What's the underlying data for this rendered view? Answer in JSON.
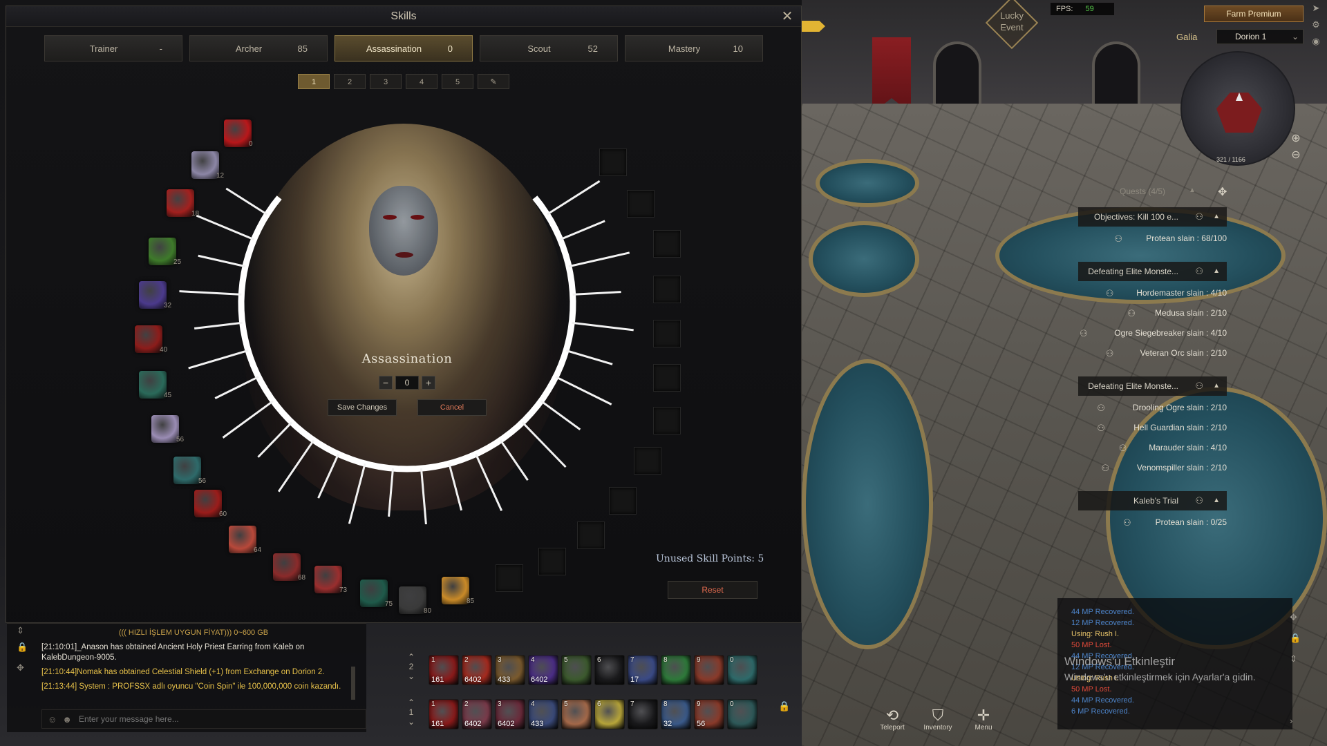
{
  "skills_window": {
    "title": "Skills",
    "class_tabs": [
      {
        "label": "Trainer",
        "value": "-"
      },
      {
        "label": "Archer",
        "value": "85"
      },
      {
        "label": "Assassination",
        "value": "0",
        "active": true
      },
      {
        "label": "Scout",
        "value": "52"
      },
      {
        "label": "Mastery",
        "value": "10"
      }
    ],
    "preset_tabs": [
      "1",
      "2",
      "3",
      "4",
      "5"
    ],
    "skill_levels": [
      "0",
      "12",
      "18",
      "25",
      "32",
      "40",
      "45",
      "56",
      "56",
      "60",
      "64",
      "68",
      "73",
      "75",
      "80",
      "85"
    ],
    "center": {
      "title": "Assassination",
      "points": "0",
      "minus": "−",
      "plus": "+",
      "save_label": "Save Changes",
      "cancel_label": "Cancel"
    },
    "unused_points": "Unused Skill Points:  5",
    "reset_label": "Reset"
  },
  "chat": {
    "top_line": "((( HIZLI İŞLEM UYGUN FİYAT))) 0~600 GB",
    "lines": [
      {
        "text": "[21:10:01]_Anason has obtained Ancient Holy Priest Earring from Kaleb on KalebDungeon-9005.",
        "color": "#e6e1d5"
      },
      {
        "text": "[21:10:44]Nomak has obtained Celestial Shield (+1) from Exchange on Dorion 2.",
        "color": "#e8c24a"
      },
      {
        "text": "[21:13:44] System :  PROFSSX adlı oyuncu \"Coin Spin\" ile 100,000,000 coin kazandı.",
        "color": "#e8c24a"
      }
    ],
    "placeholder": "Enter your message here..."
  },
  "hotbar_top": [
    {
      "key": "1",
      "count": "161",
      "color": "#8a1a1a"
    },
    {
      "key": "2",
      "count": "6402",
      "color": "#a62a1e"
    },
    {
      "key": "3",
      "count": "433",
      "color": "#7a5a2e"
    },
    {
      "key": "4",
      "count": "6402",
      "color": "#4b2d86"
    },
    {
      "key": "5",
      "count": "",
      "color": "#3c5a2e"
    },
    {
      "key": "6",
      "count": "",
      "color": "#1a1a1c"
    },
    {
      "key": "7",
      "count": "17",
      "color": "#3a4a86"
    },
    {
      "key": "8",
      "count": "",
      "color": "#2e7a3a"
    },
    {
      "key": "9",
      "count": "",
      "color": "#8a3a2a"
    },
    {
      "key": "0",
      "count": "",
      "color": "#2e6a6a"
    }
  ],
  "hotbar_bottom": [
    {
      "key": "1",
      "count": "161",
      "color": "#8a1a1a"
    },
    {
      "key": "2",
      "count": "6402",
      "color": "#7a3a4a"
    },
    {
      "key": "3",
      "count": "6402",
      "color": "#6a2a3a"
    },
    {
      "key": "4",
      "count": "433",
      "color": "#3a4a7a"
    },
    {
      "key": "5",
      "count": "",
      "color": "#a66a4a"
    },
    {
      "key": "6",
      "count": "",
      "color": "#b8a63a"
    },
    {
      "key": "7",
      "count": "",
      "color": "#1a1a1c"
    },
    {
      "key": "8",
      "count": "32",
      "color": "#3a5a8a"
    },
    {
      "key": "9",
      "count": "56",
      "color": "#8a3a2a"
    },
    {
      "key": "0",
      "count": "",
      "color": "#2e5a5a"
    }
  ],
  "hotbar_page_top": "2",
  "hotbar_page_bottom": "1",
  "bottom_menu": [
    {
      "label": "Teleport",
      "icon": "teleport-icon"
    },
    {
      "label": "Inventory",
      "icon": "inventory-icon"
    },
    {
      "label": "Menu",
      "icon": "menu-icon"
    }
  ],
  "combat_log": [
    {
      "text": "44 MP Recovered.",
      "type": "hpc"
    },
    {
      "text": "12 MP Recovered.",
      "type": "hpc"
    },
    {
      "text": "Using: Rush I.",
      "type": "use"
    },
    {
      "text": "50 MP Lost.",
      "type": "mpl"
    },
    {
      "text": "44 MP Recovered.",
      "type": "hpc"
    },
    {
      "text": "12 MP Recovered.",
      "type": "hpc"
    },
    {
      "text": "Using: Rush I.",
      "type": "use"
    },
    {
      "text": "50 MP Lost.",
      "type": "mpl"
    },
    {
      "text": "44 MP Recovered.",
      "type": "hpc"
    },
    {
      "text": "6 MP Recovered.",
      "type": "hpc"
    }
  ],
  "windows_watermark": {
    "line1": "Windows'u Etkinleştir",
    "line2": "Windows'u etkinleştirmek için Ayarlar'a gidin."
  },
  "hud": {
    "fps_label": "FPS:",
    "fps_value": "59",
    "farm_premium": "Farm Premium",
    "region": "Galia",
    "channel": "Dorion 1",
    "coords": "321 / 1166",
    "lucky_event": "Lucky Event"
  },
  "quests": {
    "title": "Quests (4/5)",
    "groups": [
      {
        "name": "Objectives: Kill 100 e...",
        "objectives": [
          "Protean slain : 68/100"
        ]
      },
      {
        "name": "Defeating Elite Monste...",
        "objectives": [
          "Hordemaster slain : 4/10",
          "Medusa slain : 2/10",
          "Ogre Siegebreaker slain : 4/10",
          "Veteran Orc slain : 2/10"
        ]
      },
      {
        "name": "Defeating Elite Monste...",
        "objectives": [
          "Drooling Ogre slain : 2/10",
          "Hell Guardian slain : 2/10",
          "Marauder slain : 4/10",
          "Venomspiller slain : 2/10"
        ]
      },
      {
        "name": "Kaleb's Trial",
        "objectives": [
          "Protean slain : 0/25"
        ]
      }
    ]
  },
  "colors": {
    "accent_gold": "#8f7a45",
    "cancel_red": "#e07a5a",
    "fps_green": "#56c94a"
  }
}
